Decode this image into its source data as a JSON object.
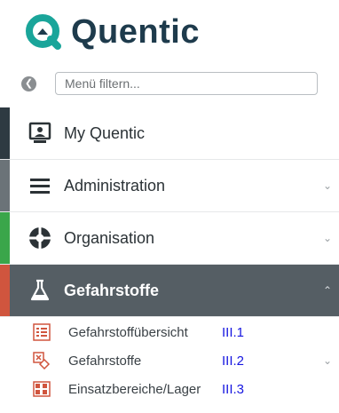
{
  "app": {
    "name": "Quentic"
  },
  "filter": {
    "placeholder": "Menü filtern..."
  },
  "nav": {
    "items": [
      {
        "label": "My Quentic",
        "bar_color": "#2e3a42"
      },
      {
        "label": "Administration",
        "bar_color": "#6b7378"
      },
      {
        "label": "Organisation",
        "bar_color": "#3aa64a"
      },
      {
        "label": "Gefahrstoffe",
        "bar_color": "#d0553e"
      }
    ]
  },
  "sub": {
    "items": [
      {
        "label": "Gefahrstoffübersicht",
        "code": "III.1"
      },
      {
        "label": "Gefahrstoffe",
        "code": "III.2"
      },
      {
        "label": "Einsatzbereiche/Lager",
        "code": "III.3"
      }
    ]
  },
  "colors": {
    "brand_teal": "#1aa59a",
    "brand_navy": "#1e3b4c",
    "active_bg": "#555e64",
    "code_blue": "#1717e0"
  }
}
